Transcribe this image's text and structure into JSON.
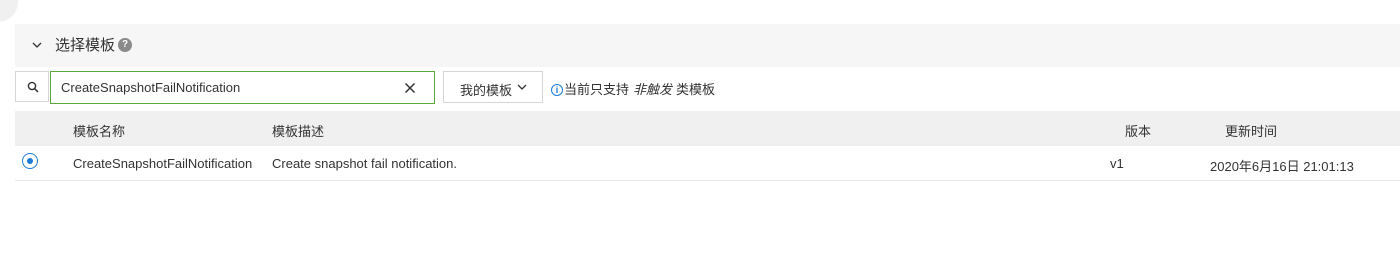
{
  "panel": {
    "title": "选择模板",
    "help_icon_glyph": "?"
  },
  "search": {
    "value": "CreateSnapshotFailNotification",
    "placeholder": ""
  },
  "filter": {
    "selected": "我的模板"
  },
  "info": {
    "prefix": "当前只支持",
    "emphasis": "非触发",
    "suffix": "类模板",
    "icon_glyph": "i"
  },
  "table": {
    "columns": {
      "name": "模板名称",
      "description": "模板描述",
      "version": "版本",
      "updated": "更新时间"
    },
    "rows": [
      {
        "selected": true,
        "name": "CreateSnapshotFailNotification",
        "description": "Create snapshot fail notification.",
        "version": "v1",
        "updated": "2020年6月16日 21:01:13"
      }
    ]
  },
  "colors": {
    "accent": "#1a7bd6",
    "input_focus_border": "#5ca63c",
    "header_bg": "#f6f6f6",
    "table_head_bg": "#f0f0f0"
  },
  "icons": [
    "chevron-down-icon",
    "help-icon",
    "search-icon",
    "clear-icon",
    "caret-down-icon",
    "info-icon",
    "radio-selected-icon"
  ]
}
